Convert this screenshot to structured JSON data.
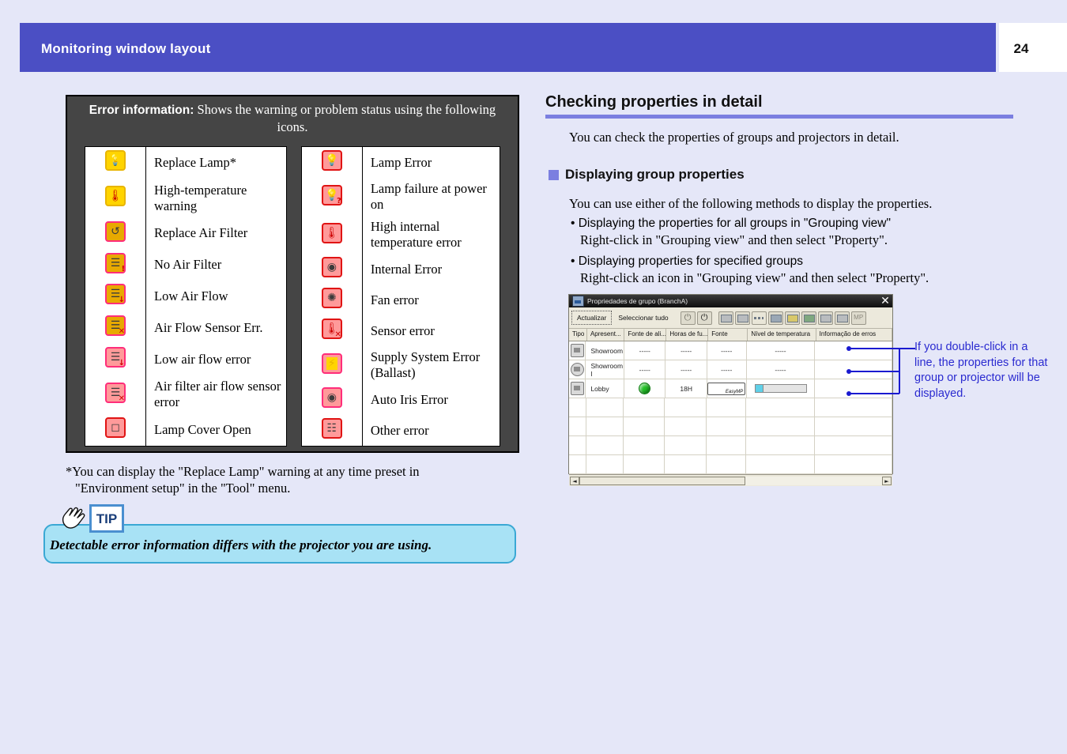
{
  "header": {
    "title": "Monitoring window layout",
    "page_number": "24"
  },
  "error_panel": {
    "head_lead": "Error information:",
    "head_rest": "Shows the warning or problem status using the following icons.",
    "left_rows": [
      {
        "icon": "replace-lamp-icon",
        "label": "Replace Lamp*"
      },
      {
        "icon": "high-temperature-warning-icon",
        "label": "High-temperature warning"
      },
      {
        "icon": "replace-air-filter-icon",
        "label": "Replace Air Filter"
      },
      {
        "icon": "no-air-filter-icon",
        "label": "No Air Filter"
      },
      {
        "icon": "low-air-flow-icon",
        "label": "Low Air Flow"
      },
      {
        "icon": "air-flow-sensor-err-icon",
        "label": "Air Flow Sensor Err."
      },
      {
        "icon": "low-air-flow-error-icon",
        "label": "Low air flow error"
      },
      {
        "icon": "air-filter-air-flow-sensor-error-icon",
        "label": "Air filter air flow sensor error"
      },
      {
        "icon": "lamp-cover-open-icon",
        "label": "Lamp Cover Open"
      }
    ],
    "right_rows": [
      {
        "icon": "lamp-error-icon",
        "label": "Lamp Error"
      },
      {
        "icon": "lamp-failure-at-power-on-icon",
        "label": "Lamp failure at power on"
      },
      {
        "icon": "high-internal-temperature-error-icon",
        "label": "High internal temperature error"
      },
      {
        "icon": "internal-error-icon",
        "label": "Internal Error"
      },
      {
        "icon": "fan-error-icon",
        "label": "Fan error"
      },
      {
        "icon": "sensor-error-icon",
        "label": "Sensor error"
      },
      {
        "icon": "supply-system-error-icon",
        "label": "Supply System Error (Ballast)"
      },
      {
        "icon": "auto-iris-error-icon",
        "label": "Auto Iris Error"
      },
      {
        "icon": "other-error-icon",
        "label": "Other error"
      }
    ]
  },
  "footnote": {
    "line1": "*You can display the \"Replace Lamp\" warning at any time preset in",
    "line2": "\"Environment setup\" in the \"Tool\" menu."
  },
  "tip": {
    "label": "TIP",
    "text": "Detectable error information differs with the projector you are using."
  },
  "right_column": {
    "section_title": "Checking properties in detail",
    "section_intro": "You can check the properties of groups and projectors in detail.",
    "sub_title": "Displaying group properties",
    "sub_intro": "You can use either of the following methods to display the properties.",
    "methods": [
      {
        "head": "• Displaying the properties for all groups in \"Grouping view\"",
        "sub": "Right-click in \"Grouping view\" and then select \"Property\"."
      },
      {
        "head": "• Displaying properties for specified groups",
        "sub": "Right-click an icon in \"Grouping view\" and then select \"Property\"."
      }
    ]
  },
  "app_window": {
    "title": "Propriedades de grupo (BranchA)",
    "close_label": "✕",
    "toolbar": {
      "refresh_label": "Actualizar",
      "select_all_label": "Seleccionar tudo",
      "icons": [
        "power-off-icon",
        "power-on-icon",
        "source-computer1-icon",
        "source-computer2-icon",
        "source-dots-icon",
        "source-video1-icon",
        "source-video2-icon",
        "source-video3-icon",
        "source-keyboard-icon",
        "source-bar-icon",
        "source-mp-icon"
      ]
    },
    "columns": [
      "Tipo",
      "Apresent...",
      "Fonte de ali...",
      "Horas de fu...",
      "Fonte",
      "Nível de temperatura",
      "Informação de erros"
    ],
    "rows": [
      {
        "type_icon": "building-icon",
        "name": "Showroom",
        "power": "-----",
        "hours": "-----",
        "source": "-----",
        "temp": "-----",
        "error": ""
      },
      {
        "type_icon": "group-icon",
        "name": "Showroom l",
        "power": "-----",
        "hours": "-----",
        "source": "-----",
        "temp": "-----",
        "error": ""
      },
      {
        "type_icon": "projector-icon",
        "name": "Lobby",
        "power": "green-led-icon",
        "hours": "18H",
        "source": "EasyMP",
        "temp": "temperature-bar",
        "temp_filled": 1,
        "temp_segments": 7,
        "error": ""
      }
    ],
    "scroll_left_arrow": "◄",
    "scroll_right_arrow": "►"
  },
  "callout": {
    "text": "If you double-click in a line, the properties for that group or projector will be displayed.",
    "color": "#2a2ad0"
  },
  "colors": {
    "page_background": "#e5e7f8",
    "header_blue": "#4b4fc4",
    "rule_blue": "#7b7fe0",
    "panel_head_gray": "#454545",
    "tip_fill": "#a8e2f5",
    "tip_border": "#3aa8d4",
    "warning_yellow": "#ffd100",
    "error_red": "#ff9a9a"
  }
}
